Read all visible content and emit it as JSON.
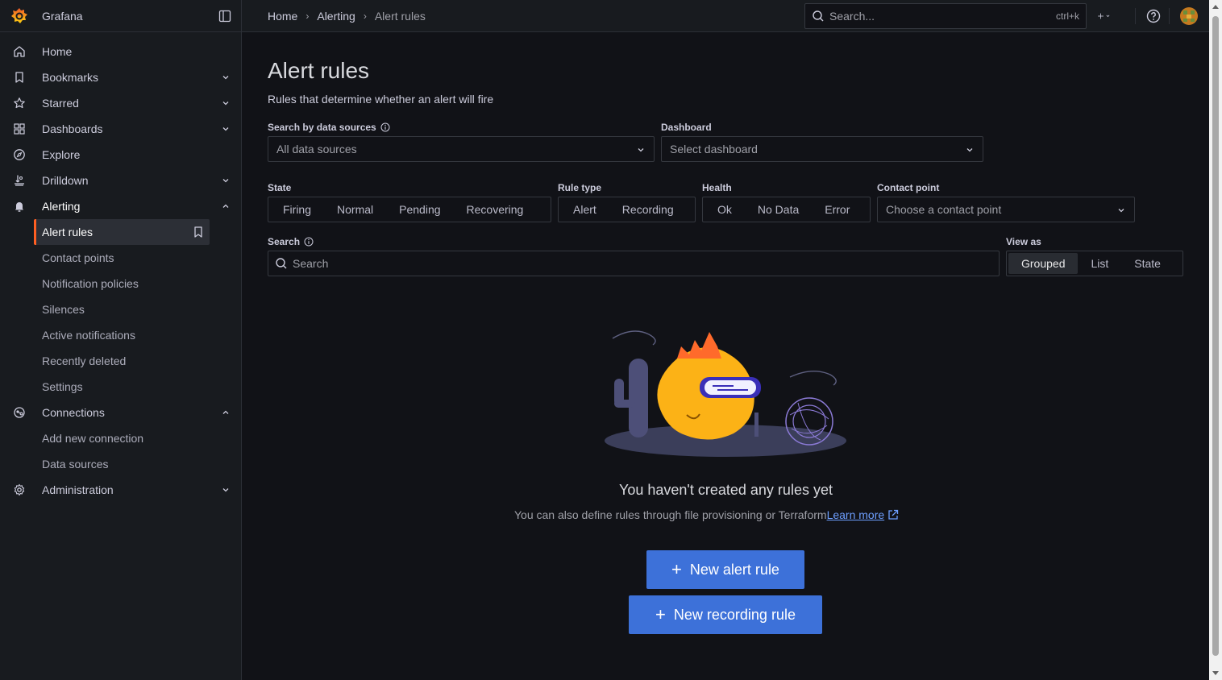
{
  "brand": {
    "name": "Grafana"
  },
  "breadcrumb": [
    "Home",
    "Alerting",
    "Alert rules"
  ],
  "topbar": {
    "search_placeholder": "Search...",
    "search_shortcut": "ctrl+k"
  },
  "sidebar": {
    "items": [
      {
        "label": "Home",
        "icon": "home-icon"
      },
      {
        "label": "Bookmarks",
        "icon": "bookmark-icon"
      },
      {
        "label": "Starred",
        "icon": "star-icon"
      },
      {
        "label": "Dashboards",
        "icon": "apps-icon"
      },
      {
        "label": "Explore",
        "icon": "compass-icon"
      },
      {
        "label": "Drilldown",
        "icon": "drilldown-icon"
      },
      {
        "label": "Alerting",
        "icon": "bell-icon"
      },
      {
        "label": "Connections",
        "icon": "connections-icon"
      },
      {
        "label": "Administration",
        "icon": "cog-icon"
      }
    ],
    "alerting_children": [
      "Alert rules",
      "Contact points",
      "Notification policies",
      "Silences",
      "Active notifications",
      "Recently deleted",
      "Settings"
    ],
    "connections_children": [
      "Add new connection",
      "Data sources"
    ]
  },
  "page": {
    "title": "Alert rules",
    "subtitle": "Rules that determine whether an alert will fire"
  },
  "filters": {
    "datasource_label": "Search by data sources",
    "datasource_value": "All data sources",
    "dashboard_label": "Dashboard",
    "dashboard_value": "Select dashboard",
    "state_label": "State",
    "state_options": [
      "Firing",
      "Normal",
      "Pending",
      "Recovering"
    ],
    "ruletype_label": "Rule type",
    "ruletype_options": [
      "Alert",
      "Recording"
    ],
    "health_label": "Health",
    "health_options": [
      "Ok",
      "No Data",
      "Error"
    ],
    "contact_label": "Contact point",
    "contact_value": "Choose a contact point",
    "search_label": "Search",
    "search_placeholder": "Search",
    "viewas_label": "View as",
    "viewas_options": [
      "Grouped",
      "List",
      "State"
    ],
    "viewas_selected": "Grouped"
  },
  "empty": {
    "title": "You haven't created any rules yet",
    "text": "You can also define rules through file provisioning or Terraform",
    "link": "Learn more",
    "new_alert": "New alert rule",
    "new_recording": "New recording rule"
  },
  "colors": {
    "accent": "#ff5f22",
    "primary": "#3d71d9",
    "link": "#6e9fff"
  }
}
